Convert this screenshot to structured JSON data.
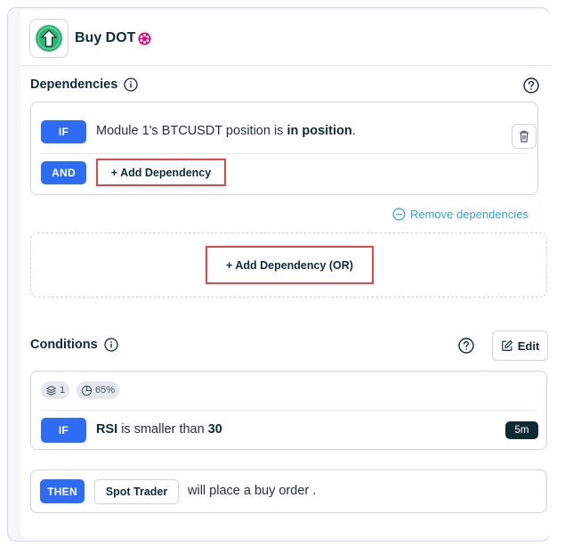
{
  "header": {
    "title": "Buy DOT",
    "strategy_icon": "arrow-up-circle-icon",
    "coin_icon": "polkadot-icon",
    "colors": {
      "accent_green": "#2bb673",
      "dot_pink": "#e6007a"
    }
  },
  "dependencies": {
    "title": "Dependencies",
    "rows": [
      {
        "badge": "IF",
        "text_before": "Module 1's BTCUSDT position is ",
        "text_bold": "in position",
        "text_after": "."
      },
      {
        "badge": "AND",
        "add_label": "+ Add Dependency"
      }
    ],
    "remove_label": "Remove dependencies",
    "add_or_label": "+ Add Dependency (OR)"
  },
  "conditions": {
    "title": "Conditions",
    "edit_label": "Edit",
    "pills": [
      {
        "icon": "layers-icon",
        "value": "1"
      },
      {
        "icon": "pie-chart-icon",
        "value": "65%"
      }
    ],
    "row": {
      "badge": "IF",
      "indicator": "RSI",
      "text": " is smaller than ",
      "value": "30",
      "timeframe": "5m"
    }
  },
  "action": {
    "badge": "THEN",
    "trader": "Spot Trader",
    "text": "will place a buy order ."
  },
  "colors": {
    "primary_blue": "#2e6cf5",
    "highlight_red": "#e0474c",
    "link_blue": "#3aa0c6",
    "dark": "#102a33"
  }
}
